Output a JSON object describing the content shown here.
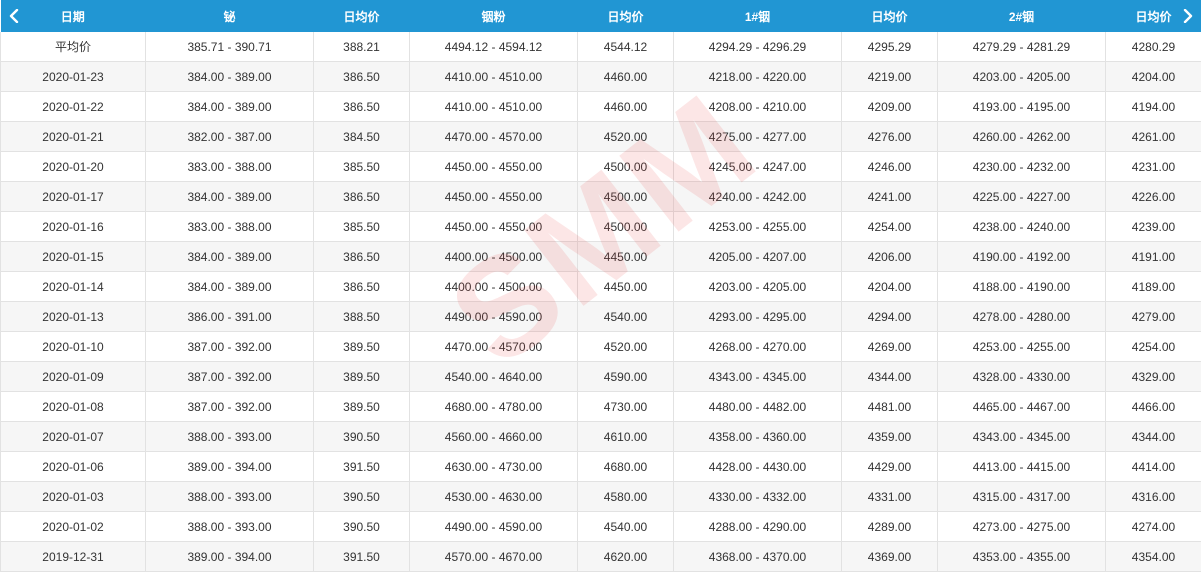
{
  "header": {
    "columns": [
      "日期",
      "铋",
      "日均价",
      "铟粉",
      "日均价",
      "1#铟",
      "日均价",
      "2#铟",
      "日均价"
    ],
    "prev_icon": "chevron-left-icon",
    "next_icon": "chevron-right-icon"
  },
  "rows": [
    [
      "平均价",
      "385.71 - 390.71",
      "388.21",
      "4494.12 - 4594.12",
      "4544.12",
      "4294.29 - 4296.29",
      "4295.29",
      "4279.29 - 4281.29",
      "4280.29"
    ],
    [
      "2020-01-23",
      "384.00 - 389.00",
      "386.50",
      "4410.00 - 4510.00",
      "4460.00",
      "4218.00 - 4220.00",
      "4219.00",
      "4203.00 - 4205.00",
      "4204.00"
    ],
    [
      "2020-01-22",
      "384.00 - 389.00",
      "386.50",
      "4410.00 - 4510.00",
      "4460.00",
      "4208.00 - 4210.00",
      "4209.00",
      "4193.00 - 4195.00",
      "4194.00"
    ],
    [
      "2020-01-21",
      "382.00 - 387.00",
      "384.50",
      "4470.00 - 4570.00",
      "4520.00",
      "4275.00 - 4277.00",
      "4276.00",
      "4260.00 - 4262.00",
      "4261.00"
    ],
    [
      "2020-01-20",
      "383.00 - 388.00",
      "385.50",
      "4450.00 - 4550.00",
      "4500.00",
      "4245.00 - 4247.00",
      "4246.00",
      "4230.00 - 4232.00",
      "4231.00"
    ],
    [
      "2020-01-17",
      "384.00 - 389.00",
      "386.50",
      "4450.00 - 4550.00",
      "4500.00",
      "4240.00 - 4242.00",
      "4241.00",
      "4225.00 - 4227.00",
      "4226.00"
    ],
    [
      "2020-01-16",
      "383.00 - 388.00",
      "385.50",
      "4450.00 - 4550.00",
      "4500.00",
      "4253.00 - 4255.00",
      "4254.00",
      "4238.00 - 4240.00",
      "4239.00"
    ],
    [
      "2020-01-15",
      "384.00 - 389.00",
      "386.50",
      "4400.00 - 4500.00",
      "4450.00",
      "4205.00 - 4207.00",
      "4206.00",
      "4190.00 - 4192.00",
      "4191.00"
    ],
    [
      "2020-01-14",
      "384.00 - 389.00",
      "386.50",
      "4400.00 - 4500.00",
      "4450.00",
      "4203.00 - 4205.00",
      "4204.00",
      "4188.00 - 4190.00",
      "4189.00"
    ],
    [
      "2020-01-13",
      "386.00 - 391.00",
      "388.50",
      "4490.00 - 4590.00",
      "4540.00",
      "4293.00 - 4295.00",
      "4294.00",
      "4278.00 - 4280.00",
      "4279.00"
    ],
    [
      "2020-01-10",
      "387.00 - 392.00",
      "389.50",
      "4470.00 - 4570.00",
      "4520.00",
      "4268.00 - 4270.00",
      "4269.00",
      "4253.00 - 4255.00",
      "4254.00"
    ],
    [
      "2020-01-09",
      "387.00 - 392.00",
      "389.50",
      "4540.00 - 4640.00",
      "4590.00",
      "4343.00 - 4345.00",
      "4344.00",
      "4328.00 - 4330.00",
      "4329.00"
    ],
    [
      "2020-01-08",
      "387.00 - 392.00",
      "389.50",
      "4680.00 - 4780.00",
      "4730.00",
      "4480.00 - 4482.00",
      "4481.00",
      "4465.00 - 4467.00",
      "4466.00"
    ],
    [
      "2020-01-07",
      "388.00 - 393.00",
      "390.50",
      "4560.00 - 4660.00",
      "4610.00",
      "4358.00 - 4360.00",
      "4359.00",
      "4343.00 - 4345.00",
      "4344.00"
    ],
    [
      "2020-01-06",
      "389.00 - 394.00",
      "391.50",
      "4630.00 - 4730.00",
      "4680.00",
      "4428.00 - 4430.00",
      "4429.00",
      "4413.00 - 4415.00",
      "4414.00"
    ],
    [
      "2020-01-03",
      "388.00 - 393.00",
      "390.50",
      "4530.00 - 4630.00",
      "4580.00",
      "4330.00 - 4332.00",
      "4331.00",
      "4315.00 - 4317.00",
      "4316.00"
    ],
    [
      "2020-01-02",
      "388.00 - 393.00",
      "390.50",
      "4490.00 - 4590.00",
      "4540.00",
      "4288.00 - 4290.00",
      "4289.00",
      "4273.00 - 4275.00",
      "4274.00"
    ],
    [
      "2019-12-31",
      "389.00 - 394.00",
      "391.50",
      "4570.00 - 4670.00",
      "4620.00",
      "4368.00 - 4370.00",
      "4369.00",
      "4353.00 - 4355.00",
      "4354.00"
    ]
  ],
  "watermark": "SMM",
  "colors": {
    "header_bg": "#2196d3",
    "header_text": "#ffffff",
    "row_alt_bg": "#f6f6f6",
    "border": "#e2e2e2",
    "watermark": "#e63c3c"
  }
}
